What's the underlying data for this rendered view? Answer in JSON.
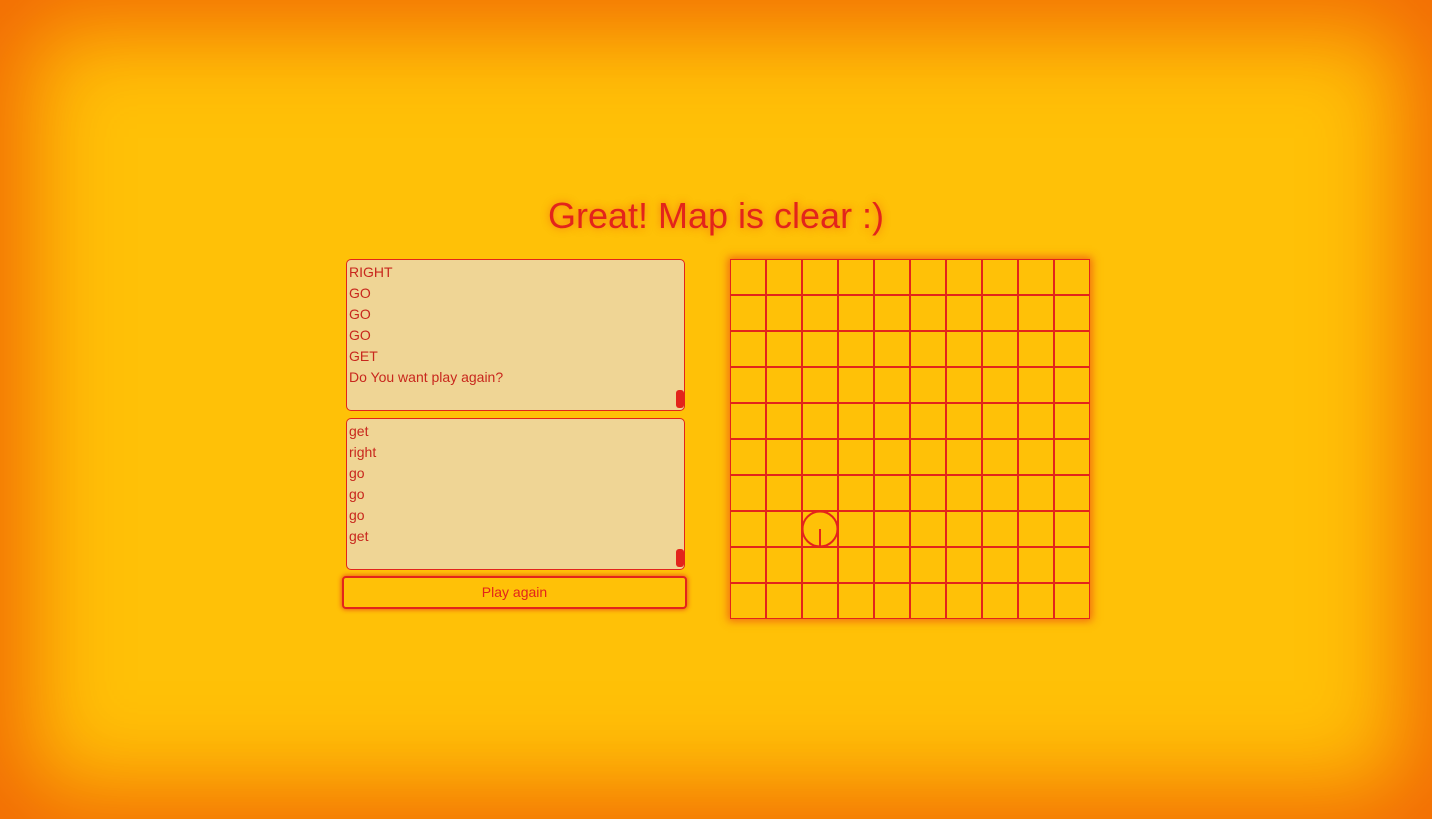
{
  "title": "Great! Map is clear :)",
  "output_log": {
    "lines": [
      "RIGHT",
      "GO",
      "GO",
      "GO",
      "GET",
      "Do You want play again?"
    ]
  },
  "input_log": {
    "lines": [
      "get",
      "right",
      "go",
      "go",
      "go",
      "get"
    ]
  },
  "play_again_label": "Play again",
  "map": {
    "rows": 10,
    "cols": 10,
    "player": {
      "col": 2,
      "row": 7,
      "facing": "down"
    },
    "grid_color": "#e3241b",
    "background_color": "#ffc107"
  },
  "colors": {
    "accent": "#e3241b",
    "background": "#ffc107",
    "edge_glow": "#f26a05",
    "log_background": "#efd595"
  }
}
